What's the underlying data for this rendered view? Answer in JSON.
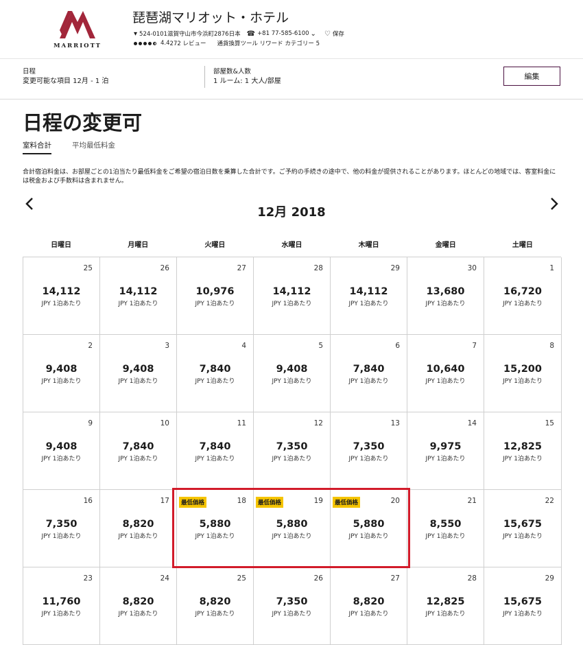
{
  "brand": {
    "logo_text": "MARRIOTT",
    "logo_color": "#a2263a"
  },
  "hotel": {
    "name": "琵琶湖マリオット・ホテル",
    "address": "524-0101滋賀守山市今浜町2876日本",
    "phone": "+81 77-585-6100",
    "save_label": "保存",
    "rating": "4.4",
    "reviews": "272 レビュー",
    "links": "通貨換算ツール リワード カテゴリー 5"
  },
  "booking": {
    "dates_label": "日程",
    "dates_value": "変更可能な項目 12月 - 1 泊",
    "rooms_label": "部屋数&人数",
    "rooms_value": "1 ルーム: 1 大人/部屋",
    "edit_label": "編集"
  },
  "page": {
    "title": "日程の変更可",
    "tab_total": "室料合計",
    "tab_average": "平均最低料金",
    "note": "合計宿泊料金は、お部屋ごとの1泊当たり最低料金をご希望の宿泊日数を乗算した合計です。ご予約の手続きの途中で、他の料金が提供されることがあります。ほとんどの地域では、客室料金には税金および手数料は含まれません。"
  },
  "calendar": {
    "month": "12月 2018",
    "prev_icon": "‹",
    "next_icon": "›",
    "weekdays": [
      "日曜日",
      "月曜日",
      "火曜日",
      "水曜日",
      "木曜日",
      "金曜日",
      "土曜日"
    ],
    "unit_label": "JPY 1泊あたり",
    "badge_label": "最低価格",
    "highlight_color": "#d21b2a",
    "badge_color": "#f5c400",
    "days": [
      {
        "day": "25",
        "price": "14,112"
      },
      {
        "day": "26",
        "price": "14,112"
      },
      {
        "day": "27",
        "price": "10,976"
      },
      {
        "day": "28",
        "price": "14,112"
      },
      {
        "day": "29",
        "price": "14,112"
      },
      {
        "day": "30",
        "price": "13,680"
      },
      {
        "day": "1",
        "price": "16,720"
      },
      {
        "day": "2",
        "price": "9,408"
      },
      {
        "day": "3",
        "price": "9,408"
      },
      {
        "day": "4",
        "price": "7,840"
      },
      {
        "day": "5",
        "price": "9,408"
      },
      {
        "day": "6",
        "price": "7,840"
      },
      {
        "day": "7",
        "price": "10,640"
      },
      {
        "day": "8",
        "price": "15,200"
      },
      {
        "day": "9",
        "price": "9,408"
      },
      {
        "day": "10",
        "price": "7,840"
      },
      {
        "day": "11",
        "price": "7,840"
      },
      {
        "day": "12",
        "price": "7,350"
      },
      {
        "day": "13",
        "price": "7,350"
      },
      {
        "day": "14",
        "price": "9,975"
      },
      {
        "day": "15",
        "price": "12,825"
      },
      {
        "day": "16",
        "price": "7,350"
      },
      {
        "day": "17",
        "price": "8,820"
      },
      {
        "day": "18",
        "price": "5,880",
        "lowest": true
      },
      {
        "day": "19",
        "price": "5,880",
        "lowest": true
      },
      {
        "day": "20",
        "price": "5,880",
        "lowest": true
      },
      {
        "day": "21",
        "price": "8,550"
      },
      {
        "day": "22",
        "price": "15,675"
      },
      {
        "day": "23",
        "price": "11,760"
      },
      {
        "day": "24",
        "price": "8,820"
      },
      {
        "day": "25",
        "price": "8,820"
      },
      {
        "day": "26",
        "price": "7,350"
      },
      {
        "day": "27",
        "price": "8,820"
      },
      {
        "day": "28",
        "price": "12,825"
      },
      {
        "day": "29",
        "price": "15,675"
      }
    ]
  }
}
